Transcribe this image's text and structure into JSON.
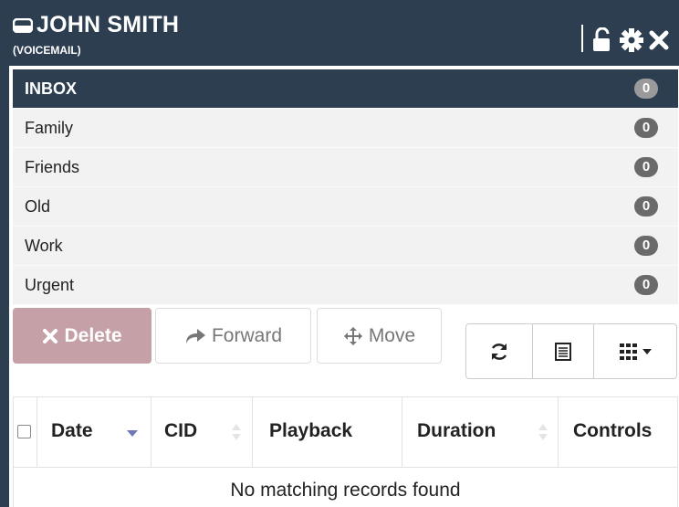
{
  "header": {
    "title": "JOHN SMITH",
    "subtitle": "(VOICEMAIL)",
    "icon": "voicemail-icon",
    "actions": [
      "unlock-icon",
      "gear-icon",
      "close-icon"
    ]
  },
  "folders": [
    {
      "label": "INBOX",
      "count": "0",
      "active": true
    },
    {
      "label": "Family",
      "count": "0"
    },
    {
      "label": "Friends",
      "count": "0"
    },
    {
      "label": "Old",
      "count": "0"
    },
    {
      "label": "Work",
      "count": "0"
    },
    {
      "label": "Urgent",
      "count": "0"
    }
  ],
  "toolbar": {
    "delete_label": "Delete",
    "forward_label": "Forward",
    "move_label": "Move",
    "icons": [
      "refresh-icon",
      "list-view-icon",
      "columns-grid-icon"
    ]
  },
  "table": {
    "columns": [
      "Date",
      "CID",
      "Playback",
      "Duration",
      "Controls"
    ],
    "empty_message": "No matching records found"
  },
  "colors": {
    "header_bg": "#2c3e50",
    "delete_bg": "#c5a0a7",
    "badge_bg": "#6a6a6a"
  }
}
